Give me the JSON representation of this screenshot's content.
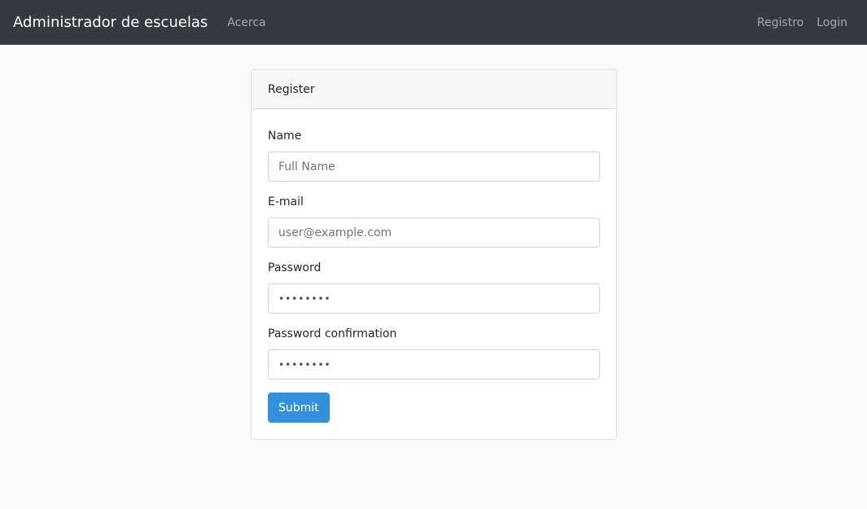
{
  "navbar": {
    "brand": "Administrador de escuelas",
    "left_links": [
      "Acerca"
    ],
    "right_links": [
      "Registro",
      "Login"
    ]
  },
  "register": {
    "title": "Register",
    "fields": {
      "name": {
        "label": "Name",
        "placeholder": "Full Name",
        "value": ""
      },
      "email": {
        "label": "E-mail",
        "placeholder": "user@example.com",
        "value": ""
      },
      "password": {
        "label": "Password",
        "value": "••••••••"
      },
      "password_confirmation": {
        "label": "Password confirmation",
        "value": "••••••••"
      }
    },
    "submit_label": "Submit"
  },
  "colors": {
    "navbar_bg": "#343a40",
    "page_bg": "#f8f9fa",
    "primary": "#3490dc"
  }
}
